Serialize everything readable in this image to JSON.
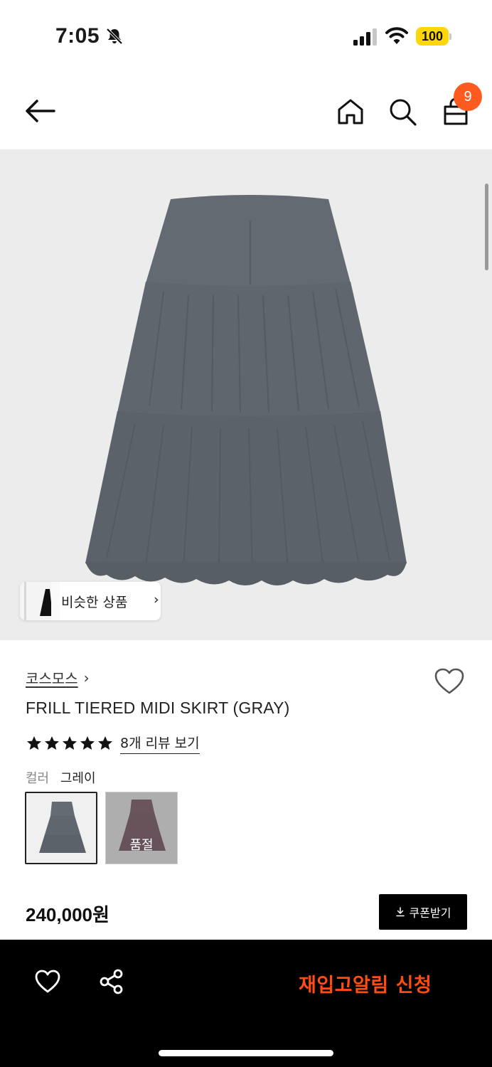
{
  "status_bar": {
    "time": "7:05",
    "battery": "100",
    "icons": [
      "bell-off-icon",
      "signal-icon",
      "wifi-icon",
      "battery-icon"
    ]
  },
  "nav": {
    "icons": [
      "back-arrow-icon",
      "home-icon",
      "search-icon",
      "shopping-bag-icon"
    ],
    "cart_count": "9"
  },
  "hero": {
    "similar_label": "비슷한 상품",
    "similar_chevron": "›"
  },
  "product": {
    "brand": "코스모스",
    "brand_chevron": "›",
    "title": "FRILL TIERED MIDI SKIRT (GRAY)",
    "rating": 5,
    "review_link": "8개 리뷰 보기",
    "color_label": "컬러",
    "color_value": "그레이",
    "swatches": [
      {
        "name": "gray",
        "selected": true
      },
      {
        "name": "wine",
        "sold_out_label": "품절"
      }
    ],
    "price": "240,000원",
    "coupon_label": "쿠폰받기"
  },
  "bottom_bar": {
    "restock_label": "재입고알림 신청",
    "icons": [
      "heart-icon",
      "share-icon"
    ]
  },
  "colors": {
    "accent": "#ff5a1f",
    "restock": "#ff4d12",
    "skirt": "#5e656d",
    "wine": "#5a2a3c",
    "battery": "#ffd60a"
  }
}
